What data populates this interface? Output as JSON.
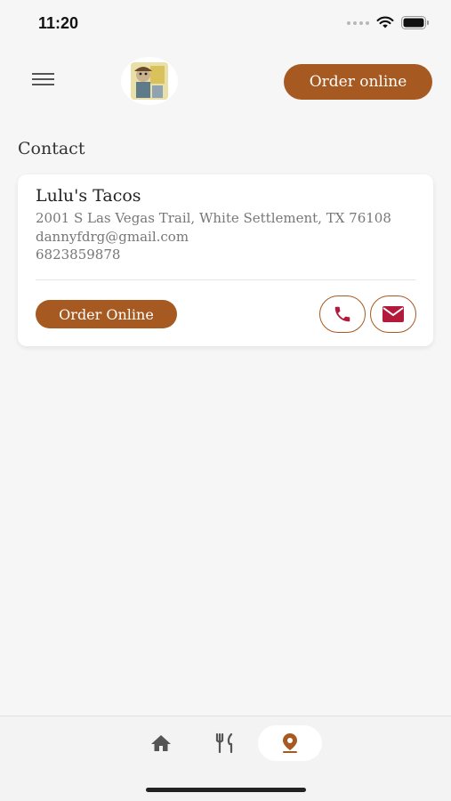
{
  "status_bar": {
    "time": "11:20"
  },
  "header": {
    "logo_alt": "Lulu's Tacos logo",
    "order_button_label": "Order online"
  },
  "section": {
    "title": "Contact"
  },
  "contact_card": {
    "name": "Lulu's Tacos",
    "address": "2001 S Las Vegas Trail, White Settlement, TX 76108",
    "email": "dannyfdrg@gmail.com",
    "phone": "6823859878",
    "order_button_label": "Order Online"
  },
  "colors": {
    "accent": "#a65920",
    "icon_red": "#b3193a",
    "nav_active": "#a65920"
  },
  "icons": {
    "menu": "hamburger-icon",
    "call": "phone-icon",
    "mail": "mail-icon",
    "home": "home-icon",
    "menu_nav": "fork-knife-icon",
    "location": "location-pin-icon"
  },
  "bottom_nav": {
    "items": [
      "home",
      "menu",
      "location"
    ],
    "active": "location"
  }
}
